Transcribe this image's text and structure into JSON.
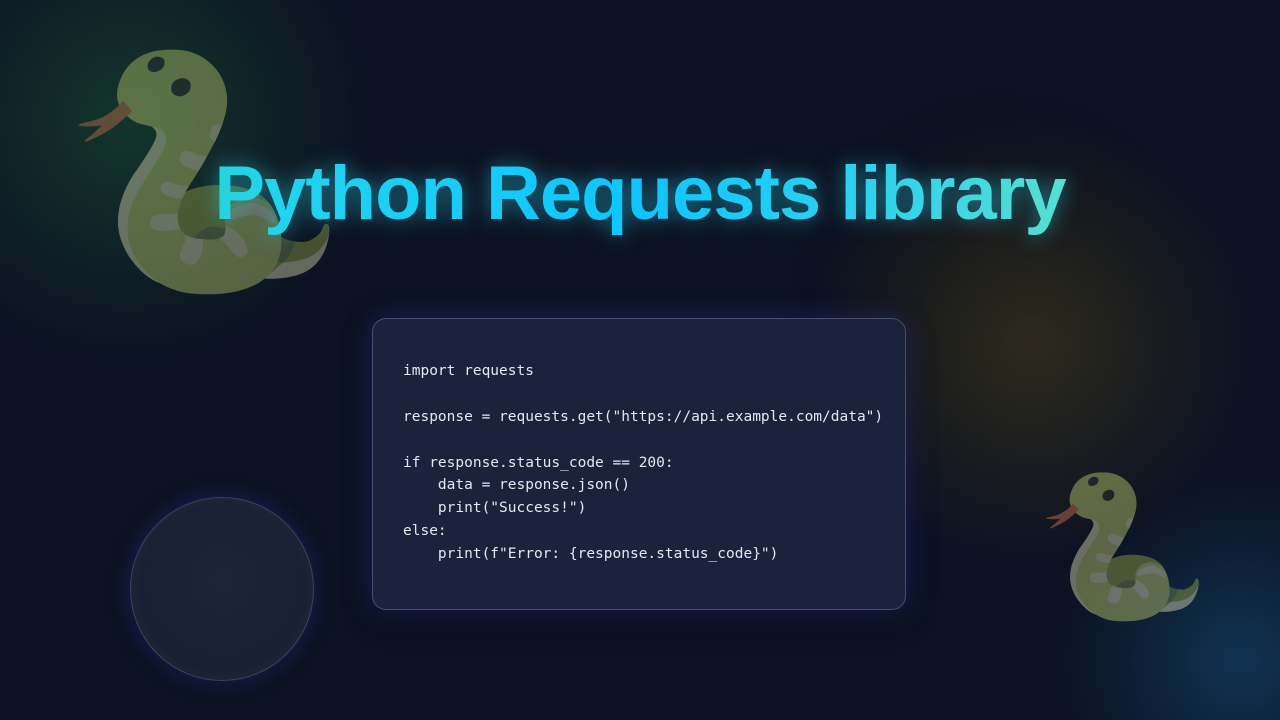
{
  "title": "Python Requests library",
  "decorations": {
    "snake_glyph": "🐍"
  },
  "code": {
    "lines": [
      "import requests",
      "",
      "response = requests.get(\"https://api.example.com/data\")",
      "",
      "if response.status_code == 200:",
      "    data = response.json()",
      "    print(\"Success!\")",
      "else:",
      "    print(f\"Error: {response.status_code}\")"
    ]
  },
  "colors": {
    "background": "#0c1222",
    "card_background": "#1b233c",
    "title_gradient_start": "#34d399",
    "title_gradient_mid": "#0ec5ff",
    "title_gradient_end": "#86efac",
    "code_text": "#e2e8f0"
  }
}
